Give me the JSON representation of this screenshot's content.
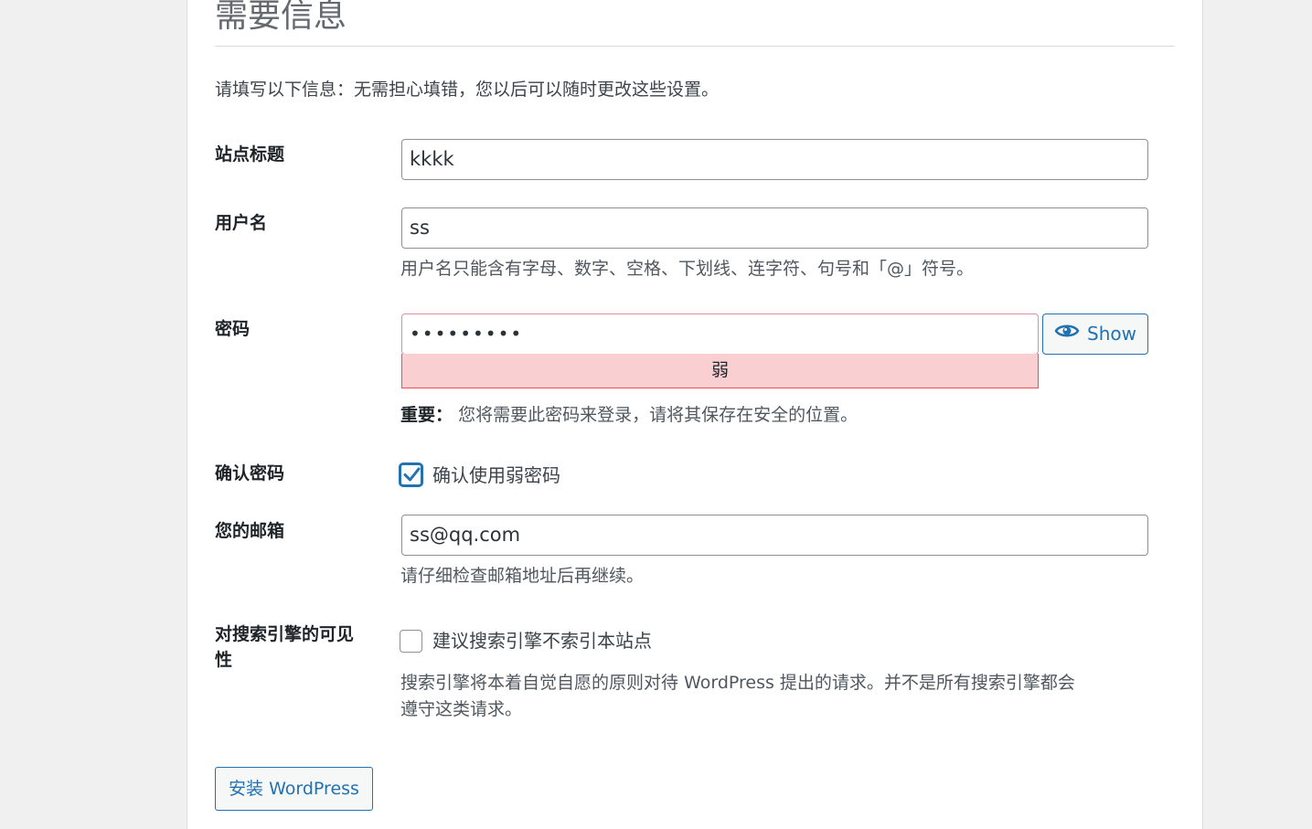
{
  "page": {
    "heading": "需要信息",
    "intro": "请填写以下信息：无需担心填错，您以后可以随时更改这些设置。"
  },
  "form": {
    "site_title": {
      "label": "站点标题",
      "value": "kkkk"
    },
    "username": {
      "label": "用户名",
      "value": "ss",
      "hint": "用户名只能含有字母、数字、空格、下划线、连字符、句号和「@」符号。"
    },
    "password": {
      "label": "密码",
      "value": "•••••••••",
      "strength": "弱",
      "show_label": "Show",
      "note_strong": "重要：",
      "note": "您将需要此密码来登录，请将其保存在安全的位置。"
    },
    "confirm_weak": {
      "label": "确认密码",
      "checkbox_label": "确认使用弱密码",
      "checked": true
    },
    "email": {
      "label": "您的邮箱",
      "value": "ss@qq.com",
      "hint": "请仔细检查邮箱地址后再继续。"
    },
    "search_visibility": {
      "label_line1": "对搜索引擎的可见",
      "label_line2": "性",
      "checkbox_label": "建议搜索引擎不索引本站点",
      "checked": false,
      "hint_line1": "搜索引擎将本着自觉自愿的原则对待 WordPress 提出的请求。并不是所有搜索引擎都会",
      "hint_line2": "遵守这类请求。"
    },
    "submit_label": "安装 WordPress"
  },
  "colors": {
    "accent": "#2271b1",
    "weak_bg": "#facfd2",
    "weak_border": "#e65054"
  }
}
